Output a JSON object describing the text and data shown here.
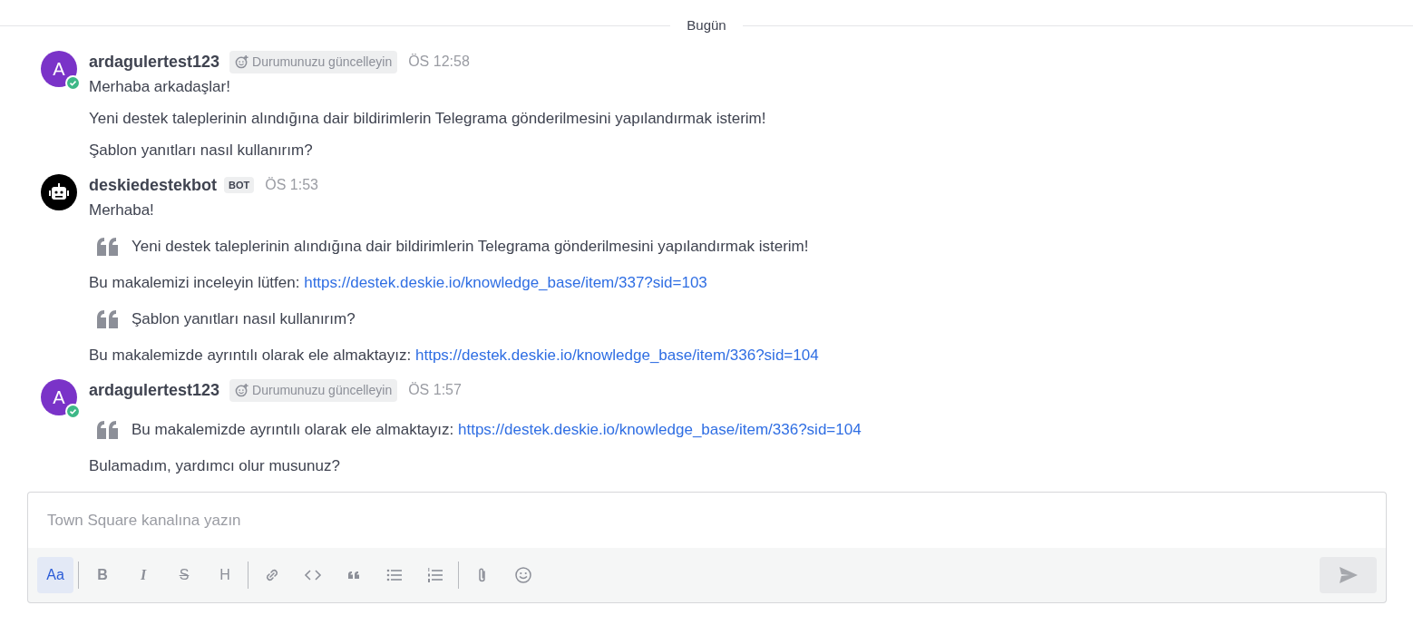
{
  "date_divider": "Bugün",
  "posts": [
    {
      "author": "ardagulertest123",
      "avatar": {
        "kind": "letter",
        "letter": "A",
        "online": true
      },
      "badge": {
        "kind": "status",
        "text": "Durumunuzu güncelleyin"
      },
      "time": "ÖS 12:58",
      "blocks": [
        {
          "kind": "text",
          "text": "Merhaba arkadaşlar!"
        },
        {
          "kind": "text",
          "text": "Yeni destek taleplerinin alındığına dair bildirimlerin Telegrama gönderilmesini yapılandırmak isterim!"
        },
        {
          "kind": "text",
          "text": "Şablon yanıtları nasıl kullanırım?"
        }
      ]
    },
    {
      "author": "deskiedestekbot",
      "avatar": {
        "kind": "bot",
        "online": false
      },
      "badge": {
        "kind": "bot",
        "text": "BOT"
      },
      "time": "ÖS 1:53",
      "blocks": [
        {
          "kind": "text",
          "text": "Merhaba!"
        },
        {
          "kind": "quote",
          "text": "Yeni destek taleplerinin alındığına dair bildirimlerin Telegrama gönderilmesini yapılandırmak isterim!"
        },
        {
          "kind": "text",
          "text": "Bu makalemizi inceleyin lütfen: ",
          "link": "https://destek.deskie.io/knowledge_base/item/337?sid=103"
        },
        {
          "kind": "quote",
          "text": "Şablon yanıtları nasıl kullanırım?"
        },
        {
          "kind": "text",
          "text": "Bu makalemizde ayrıntılı olarak ele almaktayız: ",
          "link": "https://destek.deskie.io/knowledge_base/item/336?sid=104"
        }
      ]
    },
    {
      "author": "ardagulertest123",
      "avatar": {
        "kind": "letter",
        "letter": "A",
        "online": true
      },
      "badge": {
        "kind": "status",
        "text": "Durumunuzu güncelleyin"
      },
      "time": "ÖS 1:57",
      "blocks": [
        {
          "kind": "quote",
          "text": "Bu makalemizde ayrıntılı olarak ele almaktayız: ",
          "link": "https://destek.deskie.io/knowledge_base/item/336?sid=104"
        },
        {
          "kind": "text",
          "text": "Bulamadım, yardımcı olur musunuz?"
        }
      ]
    }
  ],
  "composer": {
    "placeholder": "Town Square kanalına yazın",
    "toolbar": [
      {
        "kind": "letter",
        "label": "Aa",
        "active": true
      },
      {
        "kind": "separator"
      },
      {
        "kind": "letter",
        "label": "B",
        "active": false
      },
      {
        "kind": "letter",
        "label": "I",
        "active": false
      },
      {
        "kind": "letter",
        "label": "S",
        "active": false
      },
      {
        "kind": "letter",
        "label": "H",
        "active": false
      },
      {
        "kind": "separator"
      },
      {
        "kind": "icon",
        "active": false
      },
      {
        "kind": "icon",
        "active": false
      },
      {
        "kind": "icon",
        "active": false
      },
      {
        "kind": "icon",
        "active": false
      },
      {
        "kind": "icon",
        "active": false
      },
      {
        "kind": "separator"
      },
      {
        "kind": "icon",
        "active": false
      },
      {
        "kind": "icon",
        "active": false
      }
    ],
    "send_enabled": false
  }
}
